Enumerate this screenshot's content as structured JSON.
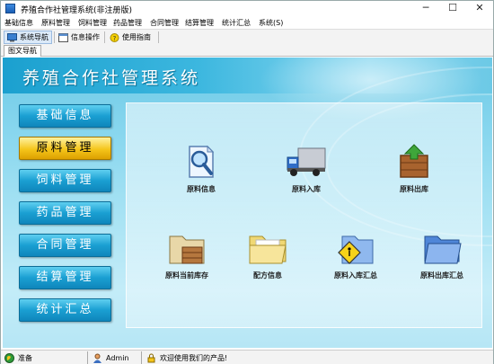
{
  "window": {
    "title": "养殖合作社管理系统(非注册版)",
    "minimize_glyph": "─",
    "maximize_glyph": "☐",
    "close_glyph": "✕"
  },
  "menu": [
    "基础信息",
    "原料管理",
    "饲料管理",
    "药品管理",
    "合同管理",
    "结算管理",
    "统计汇总",
    "系统(S)"
  ],
  "toolbar": {
    "items": [
      {
        "label": "系统导航",
        "icon": "monitor-icon"
      },
      {
        "label": "信息操作",
        "icon": "window-icon"
      },
      {
        "label": "使用指南",
        "icon": "help-icon"
      }
    ]
  },
  "tab": {
    "label": "图文导航"
  },
  "main": {
    "system_title": "养殖合作社管理系统",
    "nav_buttons": [
      {
        "label": "基础信息",
        "active": false
      },
      {
        "label": "原料管理",
        "active": true
      },
      {
        "label": "饲料管理",
        "active": false
      },
      {
        "label": "药品管理",
        "active": false
      },
      {
        "label": "合同管理",
        "active": false
      },
      {
        "label": "结算管理",
        "active": false
      },
      {
        "label": "统计汇总",
        "active": false
      }
    ],
    "items": [
      {
        "label": "原料信息",
        "icon": "search-document-icon"
      },
      {
        "label": "原料入库",
        "icon": "truck-icon"
      },
      {
        "label": "原料出库",
        "icon": "box-export-icon"
      },
      {
        "label": "原料当前库存",
        "icon": "folder-box-icon"
      },
      {
        "label": "配方信息",
        "icon": "folder-open-icon"
      },
      {
        "label": "原料入库汇总",
        "icon": "folder-sign-icon"
      },
      {
        "label": "原料出库汇总",
        "icon": "blue-folder-icon"
      }
    ]
  },
  "status": {
    "ready": "准备",
    "user": "Admin",
    "welcome": "欢迎使用我们的产品!"
  },
  "colors": {
    "accent": "#1a9fd2",
    "active_button": "#f5c51a",
    "background": "#a8e3f4"
  }
}
